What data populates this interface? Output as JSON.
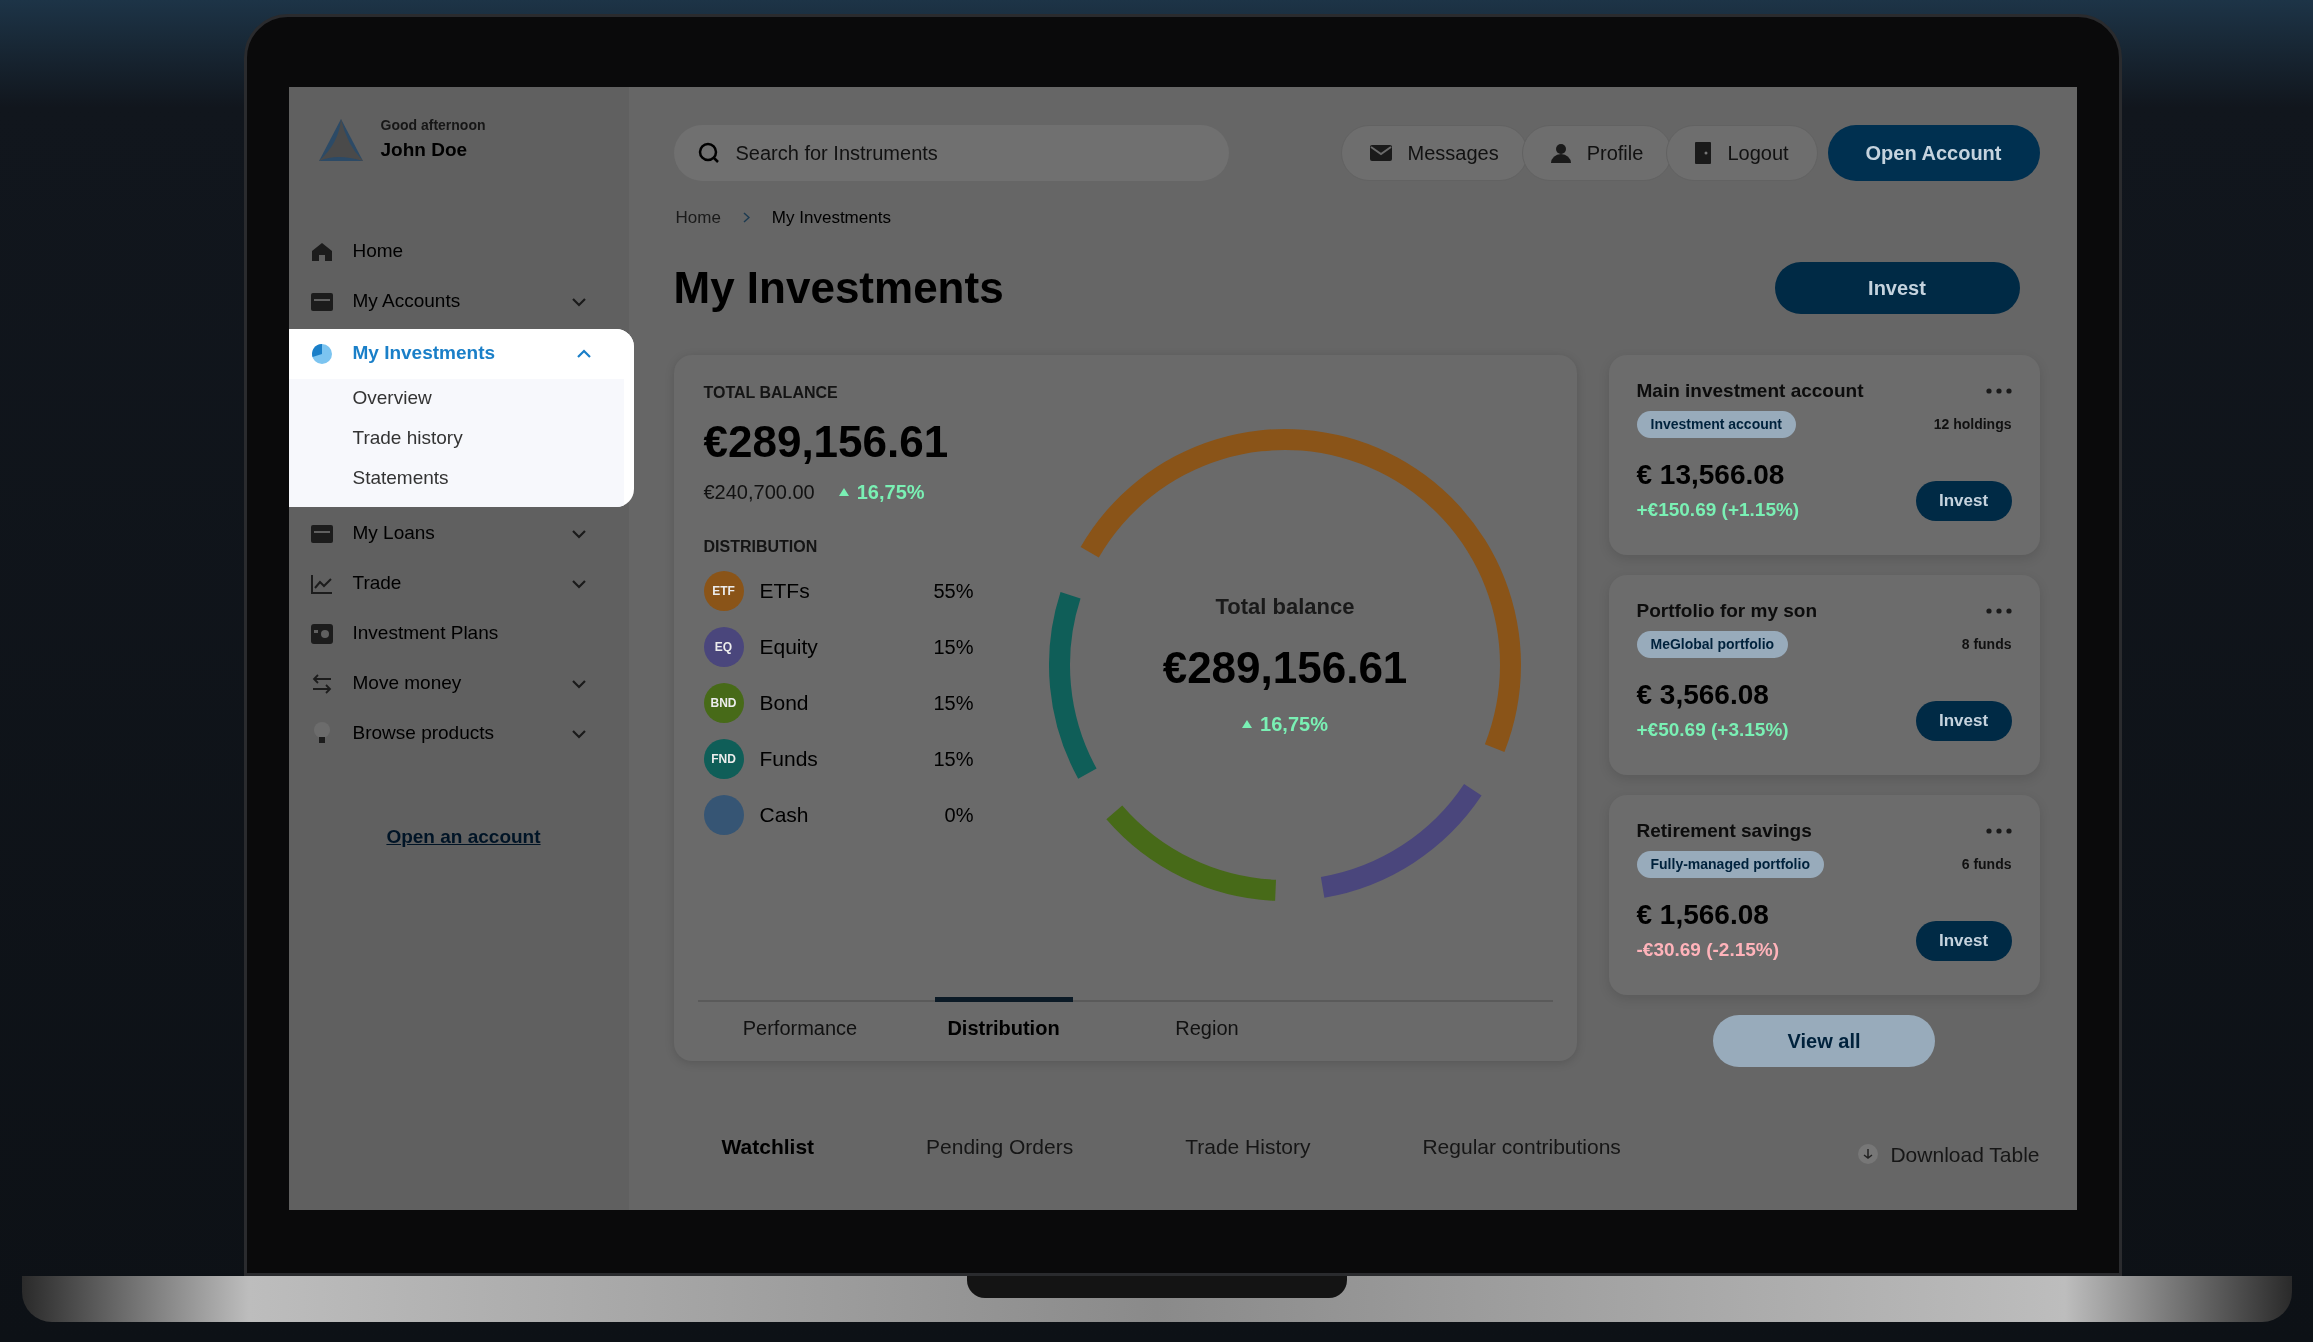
{
  "user": {
    "greeting": "Good afternoon",
    "name": "John Doe"
  },
  "sidebar": {
    "items": [
      {
        "label": "Home",
        "kind": "link",
        "selected": false
      },
      {
        "label": "My Accounts",
        "kind": "group",
        "expanded": false,
        "selected": false
      },
      {
        "label": "My Investments",
        "kind": "group",
        "expanded": true,
        "selected": true,
        "children": [
          {
            "label": "Overview"
          },
          {
            "label": "Trade history"
          },
          {
            "label": "Statements"
          }
        ]
      },
      {
        "label": "My Loans",
        "kind": "group",
        "expanded": false,
        "selected": false
      },
      {
        "label": "Trade",
        "kind": "group",
        "expanded": false,
        "selected": false
      },
      {
        "label": "Investment Plans",
        "kind": "link",
        "selected": false
      },
      {
        "label": "Move money",
        "kind": "group",
        "expanded": false,
        "selected": false
      },
      {
        "label": "Browse products",
        "kind": "group",
        "expanded": false,
        "selected": false
      }
    ],
    "footer_link": "Open an account"
  },
  "topbar": {
    "search": {
      "placeholder": "Search for Instruments"
    },
    "actions": [
      "Messages",
      "Profile",
      "Logout"
    ],
    "primary": "Open Account"
  },
  "breadcrumb": [
    "Home",
    "My Investments"
  ],
  "title": "My Investments",
  "invest_button": "Invest",
  "balance": {
    "label": "TOTAL BALANCE",
    "amount": "€289,156.61",
    "invested": "€240,700.00",
    "change": "16,75%",
    "distribution_label": "DISTRIBUTION",
    "items": [
      {
        "badge": "ETF",
        "share": "55%",
        "color": "#8a5418"
      },
      {
        "badge": "EQ",
        "share": "15%",
        "color": "#4a467c"
      },
      {
        "badge": "BND",
        "share": "15%",
        "color": "#476a18"
      },
      {
        "badge": "FND",
        "share": "15%",
        "color": "#0f5e58"
      },
      {
        "share": "0%",
        "color": "#365574"
      }
    ],
    "center": {
      "label": "Total balance",
      "amount": "€289,156.61",
      "change": "16,75%"
    },
    "chart_data": {
      "type": "donut",
      "categories": [
        "ETFs",
        "Equity",
        "Bond",
        "Funds",
        "Cash"
      ],
      "values": [
        55,
        15,
        15,
        15,
        0
      ]
    },
    "tabs": [
      {
        "label": "Performance",
        "selected": false
      },
      {
        "label": "Distribution",
        "selected": true
      },
      {
        "label": "Region",
        "selected": false
      }
    ]
  },
  "accounts": [
    {
      "title": "Main investment account",
      "tag": "Investment account",
      "count": "12 holdings",
      "amount": "€ 13,566.08",
      "change": "+€150.69 (+1.15%)",
      "negative": false,
      "button": "Invest"
    },
    {
      "title": "Portfolio for my son",
      "tag": "MeGlobal portfolio",
      "count": "8 funds",
      "amount": "€ 3,566.08",
      "change": "+€50.69 (+3.15%)",
      "negative": false,
      "button": "Invest"
    },
    {
      "title": "Retirement savings",
      "tag": "Fully-managed portfolio",
      "count": "6 funds",
      "amount": "€ 1,566.08",
      "change": "-€30.69 (-2.15%)",
      "negative": true,
      "button": "Invest"
    }
  ],
  "view_all": "View all",
  "bottom_tabs": [
    {
      "label": "Watchlist",
      "selected": true
    },
    {
      "label": "Pending Orders",
      "selected": false
    },
    {
      "label": "Trade History",
      "selected": false
    },
    {
      "label": "Regular contributions",
      "selected": false
    }
  ],
  "download": "Download Table"
}
